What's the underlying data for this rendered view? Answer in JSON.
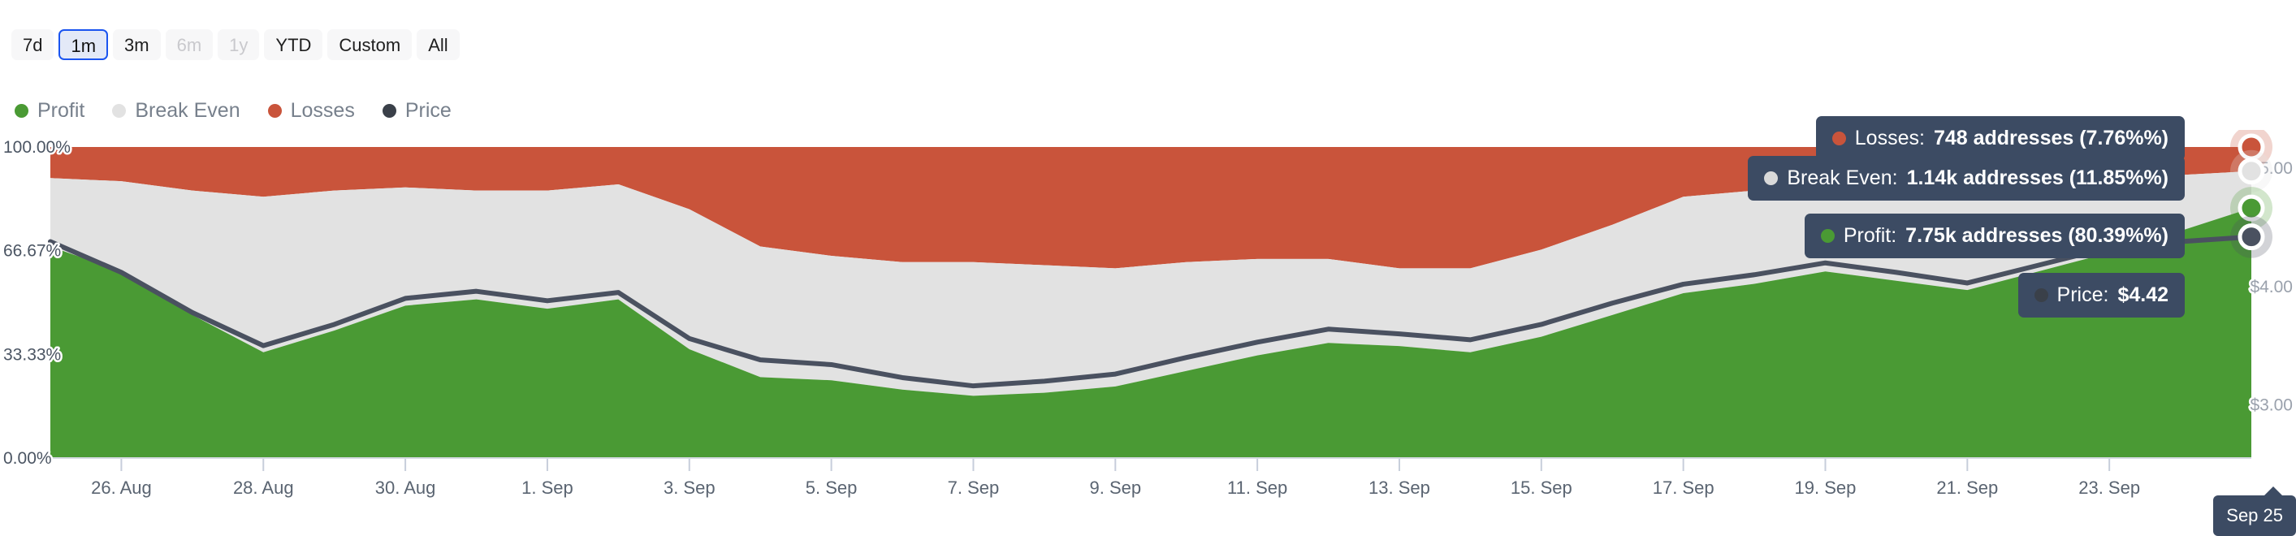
{
  "range_selector": {
    "buttons": [
      {
        "label": "7d",
        "state": "normal"
      },
      {
        "label": "1m",
        "state": "selected"
      },
      {
        "label": "3m",
        "state": "normal"
      },
      {
        "label": "6m",
        "state": "disabled"
      },
      {
        "label": "1y",
        "state": "disabled"
      },
      {
        "label": "YTD",
        "state": "normal"
      },
      {
        "label": "Custom",
        "state": "normal"
      },
      {
        "label": "All",
        "state": "normal"
      }
    ]
  },
  "legend": {
    "items": [
      {
        "label": "Profit",
        "color": "#4A9A34",
        "key": "profit"
      },
      {
        "label": "Break Even",
        "color": "#E2E2E2",
        "key": "break-even"
      },
      {
        "label": "Losses",
        "color": "#C9543B",
        "key": "losses"
      },
      {
        "label": "Price",
        "color": "#3A4049",
        "key": "price"
      }
    ]
  },
  "tooltip": {
    "losses": {
      "label": "Losses:",
      "value": "748 addresses (7.76%%)",
      "color": "#C9543B"
    },
    "break_even": {
      "label": "Break Even:",
      "value": "1.14k addresses (11.85%%)",
      "color": "#D9D9D9"
    },
    "profit": {
      "label": "Profit:",
      "value": "7.75k addresses (80.39%%)",
      "color": "#4A9A34"
    },
    "price": {
      "label": "Price:",
      "value": "$4.42",
      "color": "#3A4049"
    },
    "x_crosshair": "Sep 25"
  },
  "chart_data": {
    "type": "area",
    "title": "",
    "xlabel": "",
    "ylabel": "",
    "stacked": true,
    "stack_mode": "percent",
    "grid": true,
    "legend_position": "top-left",
    "ylim": [
      0,
      100
    ],
    "y_ticks": [
      "0.00%",
      "33.33%",
      "66.67%",
      "100.00%"
    ],
    "y_tick_values": [
      0,
      33.33,
      66.67,
      100
    ],
    "y2_ticks": [
      "$3.00",
      "$4.00",
      "$5.00"
    ],
    "y2_tick_values": [
      3.0,
      4.0,
      5.0
    ],
    "y2lim": [
      2.55,
      5.18
    ],
    "x_ticks": [
      "26. Aug",
      "28. Aug",
      "30. Aug",
      "1. Sep",
      "3. Sep",
      "5. Sep",
      "7. Sep",
      "9. Sep",
      "11. Sep",
      "13. Sep",
      "15. Sep",
      "17. Sep",
      "19. Sep",
      "21. Sep",
      "23. Sep"
    ],
    "x": [
      "25. Aug",
      "26. Aug",
      "27. Aug",
      "28. Aug",
      "29. Aug",
      "30. Aug",
      "31. Aug",
      "1. Sep",
      "2. Sep",
      "3. Sep",
      "4. Sep",
      "5. Sep",
      "6. Sep",
      "7. Sep",
      "8. Sep",
      "9. Sep",
      "10. Sep",
      "11. Sep",
      "12. Sep",
      "13. Sep",
      "14. Sep",
      "15. Sep",
      "16. Sep",
      "17. Sep",
      "18. Sep",
      "19. Sep",
      "20. Sep",
      "21. Sep",
      "22. Sep",
      "23. Sep",
      "24. Sep",
      "25. Sep"
    ],
    "series": [
      {
        "name": "Profit",
        "color": "#4A9A34",
        "values": [
          68.0,
          60.0,
          46.0,
          34.0,
          41.0,
          49.0,
          51.0,
          48.0,
          51.0,
          35.0,
          26.0,
          25.0,
          22.0,
          20.0,
          21.0,
          23.0,
          28.0,
          33.0,
          37.0,
          36.0,
          34.0,
          39.0,
          46.0,
          53.0,
          56.0,
          60.0,
          57.0,
          54.0,
          60.0,
          66.0,
          73.0,
          80.39
        ]
      },
      {
        "name": "Break Even",
        "color": "#E2E2E2",
        "values": [
          22.0,
          29.0,
          40.0,
          50.0,
          45.0,
          38.0,
          35.0,
          38.0,
          37.0,
          45.0,
          42.0,
          40.0,
          41.0,
          43.0,
          41.0,
          38.0,
          35.0,
          31.0,
          27.0,
          25.0,
          27.0,
          28.0,
          29.0,
          31.0,
          30.0,
          28.0,
          30.0,
          33.0,
          28.0,
          24.0,
          18.0,
          11.85
        ]
      },
      {
        "name": "Losses",
        "color": "#C9543B",
        "values": [
          10.0,
          11.0,
          14.0,
          16.0,
          14.0,
          13.0,
          14.0,
          14.0,
          12.0,
          20.0,
          32.0,
          35.0,
          37.0,
          37.0,
          38.0,
          39.0,
          37.0,
          36.0,
          36.0,
          39.0,
          39.0,
          33.0,
          25.0,
          16.0,
          14.0,
          12.0,
          13.0,
          13.0,
          12.0,
          10.0,
          9.0,
          7.76
        ]
      }
    ],
    "price_line": {
      "name": "Price",
      "color": "#4A5160",
      "values": [
        4.38,
        4.12,
        3.78,
        3.5,
        3.68,
        3.9,
        3.96,
        3.88,
        3.95,
        3.56,
        3.38,
        3.34,
        3.23,
        3.16,
        3.2,
        3.26,
        3.4,
        3.53,
        3.64,
        3.6,
        3.55,
        3.68,
        3.86,
        4.02,
        4.1,
        4.2,
        4.12,
        4.03,
        4.18,
        4.33,
        4.38,
        4.42
      ]
    }
  }
}
